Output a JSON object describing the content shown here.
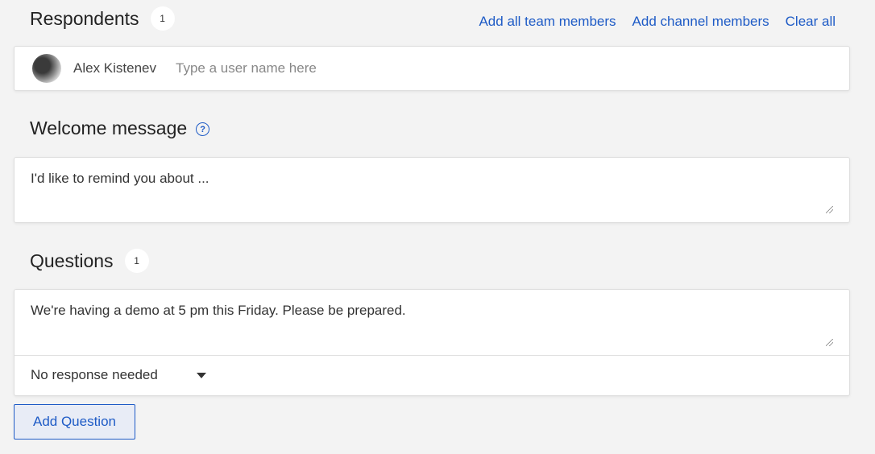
{
  "respondents": {
    "title": "Respondents",
    "count": "1",
    "links": [
      "Add all team members",
      "Add channel members",
      "Clear all"
    ],
    "selected_users": [
      {
        "name": "Alex Kistenev",
        "avatar_icon": "user-photo"
      }
    ],
    "input_placeholder": "Type a user name here"
  },
  "welcome": {
    "title": "Welcome message",
    "help_icon": "question-circle-icon",
    "value": "I'd like to remind you about ..."
  },
  "questions": {
    "title": "Questions",
    "count": "1",
    "items": [
      {
        "text": "We're having a demo at 5 pm this Friday. Please be prepared.",
        "response_type": "No response needed"
      }
    ],
    "add_label": "Add Question"
  },
  "colors": {
    "accent": "#1e5bc6",
    "background": "#f3f3f3"
  }
}
